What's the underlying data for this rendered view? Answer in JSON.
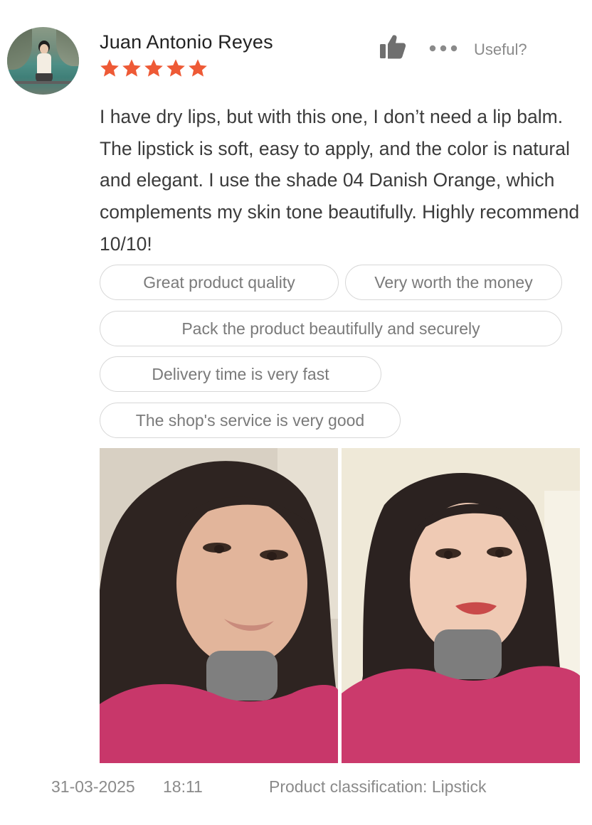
{
  "review": {
    "user_name": "Juan Antonio Reyes",
    "rating": 5,
    "rating_max": 5,
    "star_color": "#ee5a36",
    "useful_label": "Useful?",
    "icons": {
      "like": "thumbs-up-icon",
      "more": "more-dots-icon"
    },
    "text": "I have dry lips, but with this one, I don’t need a lip balm. The lipstick is soft, easy to apply, and the color is natural and elegant. I use the shade 04 Danish Orange, which complements my skin tone beautifully. Highly recommend 10/10!",
    "tags": [
      "Great product quality",
      "Very worth the money",
      "Pack the product beautifully and securely",
      "Delivery time is very fast",
      "The shop's service is very good"
    ],
    "photos_count": 2,
    "date": "31-03-2025",
    "time": "18:11",
    "classification": "Product classification: Lipstick"
  }
}
